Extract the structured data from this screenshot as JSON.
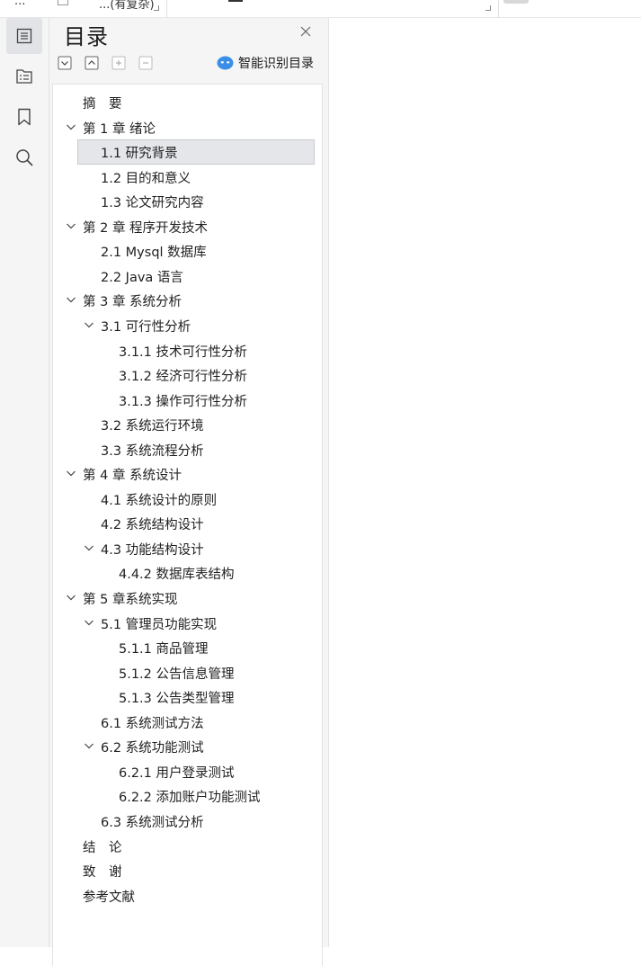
{
  "topbar": {
    "fragment_left": "...",
    "fragment_mid": "...(有复杂)"
  },
  "sidebar_icons": [
    {
      "name": "toc-icon",
      "active": true
    },
    {
      "name": "outline-icon",
      "active": false
    },
    {
      "name": "bookmark-icon",
      "active": false
    },
    {
      "name": "search-icon",
      "active": false
    }
  ],
  "panel": {
    "title": "目录",
    "smart_label": "智能识别目录",
    "tools": [
      "collapse-all-icon",
      "expand-all-icon",
      "add-icon",
      "remove-icon"
    ]
  },
  "toc": [
    {
      "label": "摘　要",
      "level": 0,
      "chevron": false
    },
    {
      "label": "第 1 章  绪论",
      "level": 0,
      "chevron": true
    },
    {
      "label": "1.1  研究背景",
      "level": 1,
      "chevron": false,
      "selected": true
    },
    {
      "label": "1.2 目的和意义",
      "level": 1,
      "chevron": false
    },
    {
      "label": "1.3  论文研究内容",
      "level": 1,
      "chevron": false
    },
    {
      "label": "第 2 章  程序开发技术",
      "level": 0,
      "chevron": true
    },
    {
      "label": "2.1 Mysql 数据库",
      "level": 1,
      "chevron": false
    },
    {
      "label": "2.2 Java 语言",
      "level": 1,
      "chevron": false
    },
    {
      "label": "第 3 章  系统分析",
      "level": 0,
      "chevron": true
    },
    {
      "label": "3.1 可行性分析",
      "level": 1,
      "chevron": true
    },
    {
      "label": "3.1.1 技术可行性分析",
      "level": 2,
      "chevron": false
    },
    {
      "label": "3.1.2 经济可行性分析",
      "level": 2,
      "chevron": false
    },
    {
      "label": "3.1.3 操作可行性分析",
      "level": 2,
      "chevron": false
    },
    {
      "label": "3.2 系统运行环境",
      "level": 1,
      "chevron": false
    },
    {
      "label": "3.3 系统流程分析",
      "level": 1,
      "chevron": false
    },
    {
      "label": "第 4 章  系统设计",
      "level": 0,
      "chevron": true
    },
    {
      "label": "4.1  系统设计的原则",
      "level": 1,
      "chevron": false
    },
    {
      "label": "4.2  系统结构设计",
      "level": 1,
      "chevron": false
    },
    {
      "label": "4.3 功能结构设计",
      "level": 1,
      "chevron": true
    },
    {
      "label": "4.4.2  数据库表结构",
      "level": 2,
      "chevron": false
    },
    {
      "label": "第 5 章系统实现",
      "level": 0,
      "chevron": true
    },
    {
      "label": "5.1 管理员功能实现",
      "level": 1,
      "chevron": true
    },
    {
      "label": "5.1.1  商品管理",
      "level": 2,
      "chevron": false
    },
    {
      "label": "5.1.2  公告信息管理",
      "level": 2,
      "chevron": false
    },
    {
      "label": "5.1.3 公告类型管理",
      "level": 2,
      "chevron": false
    },
    {
      "label": "6.1 系统测试方法",
      "level": 1,
      "chevron": false
    },
    {
      "label": "6.2  系统功能测试",
      "level": 1,
      "chevron": true
    },
    {
      "label": "6.2.1  用户登录测试",
      "level": 2,
      "chevron": false
    },
    {
      "label": "6.2.2  添加账户功能测试",
      "level": 2,
      "chevron": false
    },
    {
      "label": "6.3  系统测试分析",
      "level": 1,
      "chevron": false
    },
    {
      "label": "结　论",
      "level": 0,
      "chevron": false
    },
    {
      "label": "致　谢",
      "level": 0,
      "chevron": false
    },
    {
      "label": "参考文献",
      "level": 0,
      "chevron": false
    }
  ],
  "colors": {
    "accent": "#3a8ee6",
    "selected_bg": "#e4e6ea",
    "panel_bg": "#f5f5f5"
  }
}
